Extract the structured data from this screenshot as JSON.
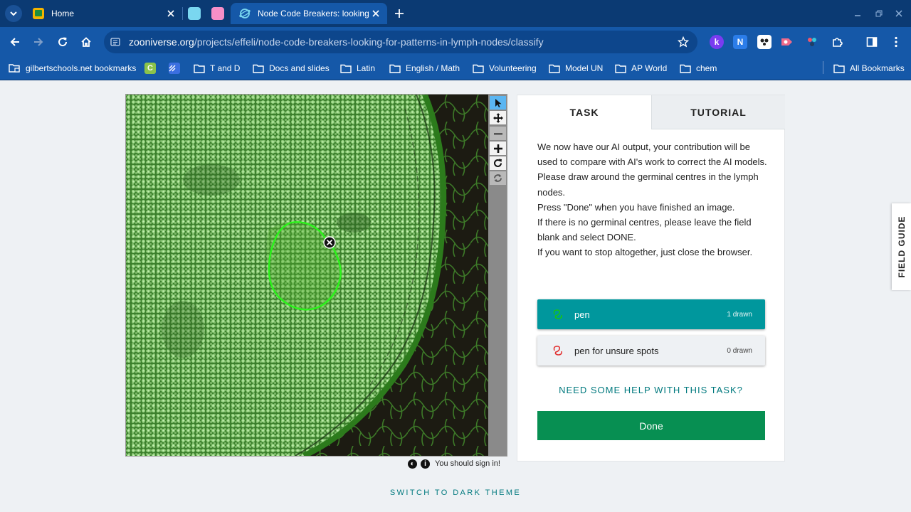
{
  "browser": {
    "tabs": [
      {
        "title": "Home"
      },
      {
        "title": "Node Code Breakers: looking fo"
      }
    ],
    "url": {
      "host": "zooniverse.org",
      "path": "/projects/effeli/node-code-breakers-looking-for-patterns-in-lymph-nodes/classify"
    },
    "extensions": [
      "k",
      "N"
    ],
    "bookmarks": {
      "items": [
        {
          "label": "gilbertschools.net bookmarks"
        },
        {
          "label": "T and D"
        },
        {
          "label": "Docs and slides"
        },
        {
          "label": "Latin"
        },
        {
          "label": "English / Math"
        },
        {
          "label": "Volunteering"
        },
        {
          "label": "Model UN"
        },
        {
          "label": "AP World"
        },
        {
          "label": "chem"
        }
      ],
      "all_label": "All Bookmarks",
      "c_icon_letter": "C"
    }
  },
  "viewer": {
    "tools": [
      "pointer-tool",
      "pan-tool",
      "zoom-out-tool",
      "zoom-in-tool",
      "rotate-tool",
      "reset-tool"
    ],
    "active_tool": "pointer-tool",
    "signin_text": "You should sign in!"
  },
  "panel": {
    "tabs": {
      "task": "TASK",
      "tutorial": "TUTORIAL"
    },
    "instructions": [
      "We now have our AI output, your contribution will be used to compare with AI's work to correct the AI models.",
      "Please draw around the germinal centres in the lymph nodes.",
      "Press \"Done\" when you have finished an image.",
      "If there is no germinal centres, please leave the field blank and select DONE.",
      "If you want to stop altogether, just close the browser."
    ],
    "tool_choices": [
      {
        "label": "pen",
        "count": "1 drawn",
        "color": "#16c516",
        "selected": true
      },
      {
        "label": "pen for unsure spots",
        "count": "0 drawn",
        "color": "#e23434",
        "selected": false
      }
    ],
    "help_label": "NEED SOME HELP WITH THIS TASK?",
    "done_label": "Done"
  },
  "field_guide_label": "FIELD GUIDE",
  "dark_theme_label": "SWITCH TO DARK THEME",
  "colors": {
    "chrome_dark": "#0b3a73",
    "chrome": "#1558a8",
    "teal": "#00979d",
    "done_green": "#078f52",
    "tissue_green": "#3f8a2f"
  }
}
